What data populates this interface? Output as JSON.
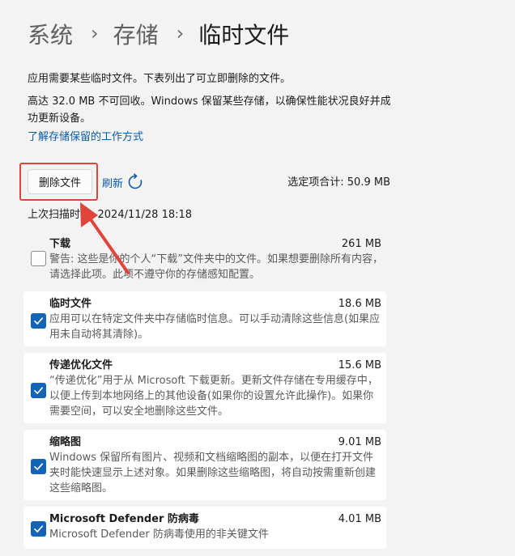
{
  "breadcrumb": {
    "items": [
      "系统",
      "存储",
      "临时文件"
    ],
    "separator": "›"
  },
  "description": {
    "line1": "应用需要某些临时文件。下表列出了可立即删除的文件。",
    "line2": "高达 32.0 MB 不可回收。Windows 保留某些存储，以确保性能状况良好并成功更新设备。"
  },
  "learn_link": "了解存储保留的工作方式",
  "toolbar": {
    "delete_label": "删除文件",
    "refresh_label": "刷新",
    "refresh_icon": "refresh-icon",
    "total_label": "选定项合计: 50.9 MB"
  },
  "scan_time": "上次扫描时间: 2024/11/28 18:18",
  "items": [
    {
      "title": "下载",
      "size": "261 MB",
      "description": "警告: 这些是你的个人“下载”文件夹中的文件。如果想要删除所有内容，请选择此项。此项不遵守你的存储感知配置。",
      "checked": false
    },
    {
      "title": "临时文件",
      "size": "18.6 MB",
      "description": "应用可以在特定文件夹中存储临时信息。可以手动清除这些信息(如果应用未自动将其清除)。",
      "checked": true
    },
    {
      "title": "传递优化文件",
      "size": "15.6 MB",
      "description": "“传递优化”用于从 Microsoft 下载更新。更新文件存储在专用缓存中，以便上传到本地网络上的其他设备(如果你的设置允许此操作)。如果你需要空间，可以安全地删除这些文件。",
      "checked": true
    },
    {
      "title": "缩略图",
      "size": "9.01 MB",
      "description": "Windows 保留所有图片、视频和文档缩略图的副本，以便在打开文件夹时能快速显示上述对象。如果删除这些缩略图，将自动按需重新创建这些缩略图。",
      "checked": true
    },
    {
      "title": "Microsoft Defender 防病毒",
      "size": "4.01 MB",
      "description": "Microsoft Defender 防病毒使用的非关键文件",
      "checked": true
    }
  ],
  "colors": {
    "accent": "#1363b6",
    "link": "#0a5aa8",
    "annotation": "#e0453b"
  }
}
